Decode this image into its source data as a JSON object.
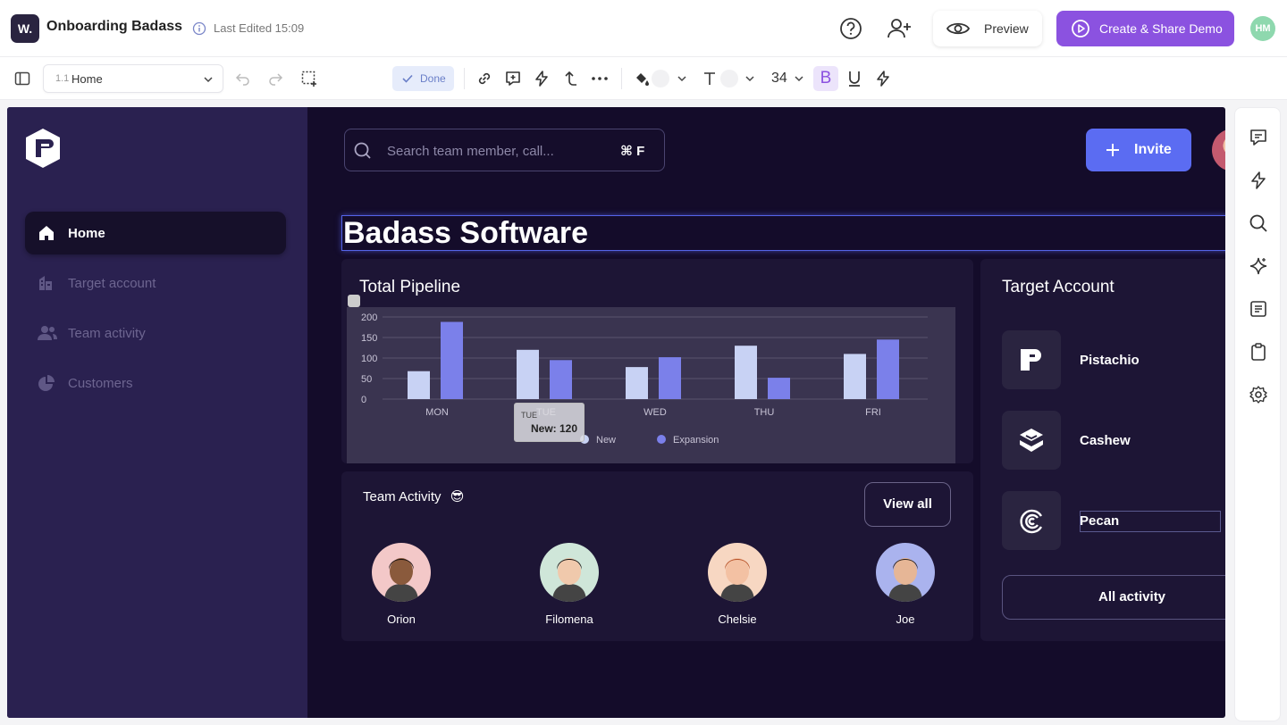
{
  "app": {
    "logo_letter": "W.",
    "title": "Onboarding Badass",
    "last_edited": "Last Edited 15:09",
    "preview_label": "Preview",
    "create_label": "Create & Share Demo",
    "user_initials": "HM"
  },
  "toolbar": {
    "page_number": "1.1",
    "page_name": "Home",
    "done_label": "Done",
    "font_size": "34",
    "bold_label": "B"
  },
  "demo": {
    "sidebar": {
      "items": [
        {
          "label": "Home",
          "icon": "home-icon",
          "active": true
        },
        {
          "label": "Target account",
          "icon": "building-icon"
        },
        {
          "label": "Team activity",
          "icon": "team-icon"
        },
        {
          "label": "Customers",
          "icon": "pie-chart-icon"
        }
      ]
    },
    "search": {
      "placeholder": "Search team member, call...",
      "shortcut": "⌘ F"
    },
    "invite_label": "Invite",
    "heading": "Badass Software",
    "pipeline": {
      "title": "Total Pipeline",
      "tooltip_day": "TUE",
      "tooltip_value": "New: 120"
    },
    "team": {
      "title": "Team Activity",
      "emoji": "😎",
      "view_all": "View all",
      "members": [
        {
          "name": "Orion",
          "bg": "#f3c8c8",
          "skin": "#8a5a3c",
          "hair": "#1b1210"
        },
        {
          "name": "Filomena",
          "bg": "#cfe6d9",
          "skin": "#f0c9ac",
          "hair": "#1a1412"
        },
        {
          "name": "Chelsie",
          "bg": "#f7d7c2",
          "skin": "#f3c1a3",
          "hair": "#b8542b"
        },
        {
          "name": "Joe",
          "bg": "#aab3ee",
          "skin": "#e6b696",
          "hair": "#2b201a"
        }
      ]
    },
    "accounts": {
      "title": "Target Account",
      "items": [
        {
          "name": "Pistachio",
          "icon": "pistachio-logo-icon"
        },
        {
          "name": "Cashew",
          "icon": "cashew-logo-icon"
        },
        {
          "name": "Pecan",
          "icon": "pecan-logo-icon"
        }
      ],
      "all_activity": "All activity"
    }
  },
  "chart_data": {
    "type": "bar",
    "categories": [
      "MON",
      "TUE",
      "WED",
      "THU",
      "FRI"
    ],
    "series": [
      {
        "name": "New",
        "color": "#c8d2f4",
        "values": [
          68,
          120,
          78,
          130,
          110
        ]
      },
      {
        "name": "Expansion",
        "color": "#7b80ea",
        "values": [
          188,
          95,
          102,
          52,
          145
        ]
      }
    ],
    "ylim": [
      0,
      200
    ],
    "yticks": [
      0,
      50,
      100,
      150,
      200
    ],
    "grid": true,
    "legend": "bottom-center"
  }
}
